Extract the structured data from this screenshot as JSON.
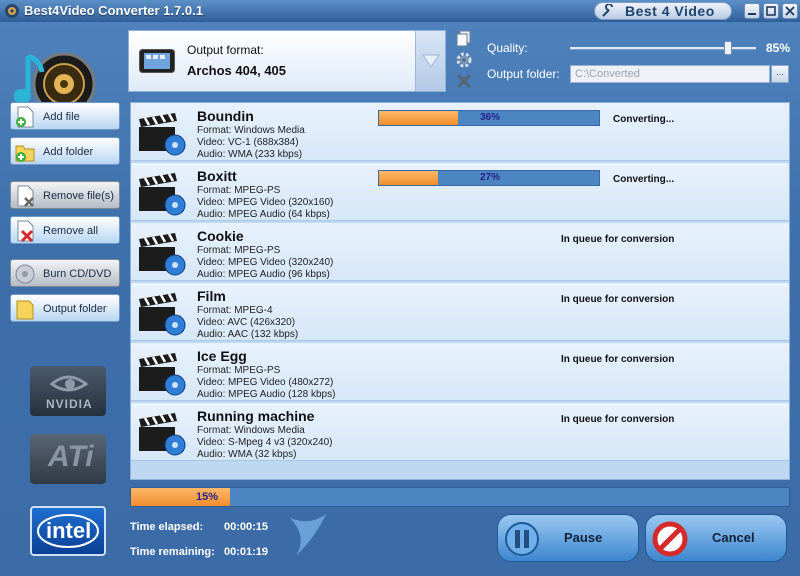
{
  "window": {
    "title": "Best4Video Converter 1.7.0.1",
    "brand": "Best 4 Video"
  },
  "output": {
    "format_label": "Output format:",
    "format_value": "Archos 404, 405",
    "quality_label": "Quality:",
    "quality_value": "85%",
    "quality_fraction": 0.85,
    "folder_label": "Output folder:",
    "folder_value": "C:\\Converted",
    "browse_label": "..."
  },
  "sidebar": {
    "add_file": "Add file",
    "add_folder": "Add folder",
    "remove_files": "Remove file(s)",
    "remove_all": "Remove all",
    "burn": "Burn CD/DVD",
    "output_folder": "Output folder"
  },
  "vendors": {
    "nvidia": "NVIDIA",
    "ati": "ATi",
    "intel": "intel"
  },
  "files": [
    {
      "name": "Boundin",
      "format": "Format: Windows Media",
      "video": "Video: VC-1 (688x384)",
      "audio": "Audio: WMA (233 kbps)",
      "status": "Converting...",
      "progress_label": "36%",
      "progress": 0.36
    },
    {
      "name": "Boxitt",
      "format": "Format: MPEG-PS",
      "video": "Video: MPEG Video (320x160)",
      "audio": "Audio: MPEG Audio (64 kbps)",
      "status": "Converting...",
      "progress_label": "27%",
      "progress": 0.27
    },
    {
      "name": "Cookie",
      "format": "Format: MPEG-PS",
      "video": "Video: MPEG Video (320x240)",
      "audio": "Audio: MPEG Audio (96 kbps)",
      "status": "In queue for conversion"
    },
    {
      "name": "Film",
      "format": "Format: MPEG-4",
      "video": "Video: AVC (426x320)",
      "audio": "Audio: AAC (132 kbps)",
      "status": "In queue for conversion"
    },
    {
      "name": "Ice Egg",
      "format": "Format: MPEG-PS",
      "video": "Video: MPEG Video (480x272)",
      "audio": "Audio: MPEG Audio (128 kbps)",
      "status": "In queue for conversion"
    },
    {
      "name": "Running machine",
      "format": "Format: Windows Media",
      "video": "Video: S-Mpeg 4 v3 (320x240)",
      "audio": "Audio: WMA (32 kbps)",
      "status": "In queue for conversion"
    }
  ],
  "overall": {
    "progress_label": "15%",
    "progress": 0.15,
    "elapsed_label": "Time elapsed:",
    "elapsed_value": "00:00:15",
    "remaining_label": "Time remaining:",
    "remaining_value": "00:01:19"
  },
  "actions": {
    "pause": "Pause",
    "cancel": "Cancel"
  },
  "colors": {
    "progress_fill": "#f08e2b",
    "progress_track": "#4d85c2",
    "window_bg": "#3d6fab"
  }
}
